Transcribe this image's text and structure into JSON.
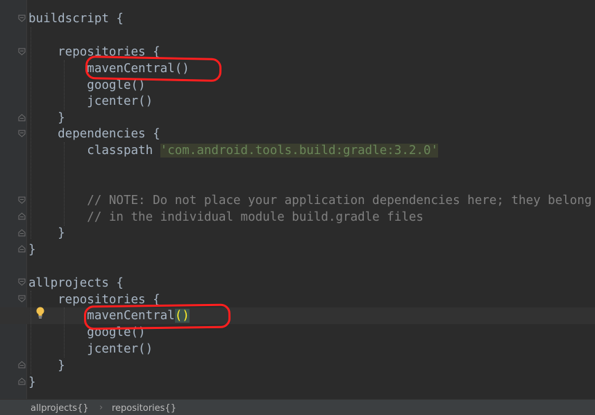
{
  "code": {
    "l1": "buildscript {",
    "l2": "    repositories {",
    "l3": "        mavenCentral()",
    "l4": "        google()",
    "l5": "        jcenter()",
    "l6": "    }",
    "l7": "    dependencies {",
    "l8_prefix": "        classpath ",
    "l8_string": "'com.android.tools.build:gradle:3.2.0'",
    "l9": "        // NOTE: Do not place your application dependencies here; they belong",
    "l10": "        // in the individual module build.gradle files",
    "l11": "    }",
    "l12": "}",
    "l13": "allprojects {",
    "l14": "    repositories {",
    "l15_prefix": "        mavenCentral",
    "l15_paren": "()",
    "l16": "        google()",
    "l17": "        jcenter()",
    "l18": "    }",
    "l19": "}"
  },
  "breadcrumb": {
    "item1": "allprojects{}",
    "item2": "repositories{}"
  },
  "colors": {
    "background": "#2b2b2b",
    "gutter": "#313335",
    "text": "#a9b7c6",
    "string": "#6a8759",
    "comment": "#808080",
    "brace_match": "#ffef28",
    "annotation": "#ff1f1f"
  }
}
